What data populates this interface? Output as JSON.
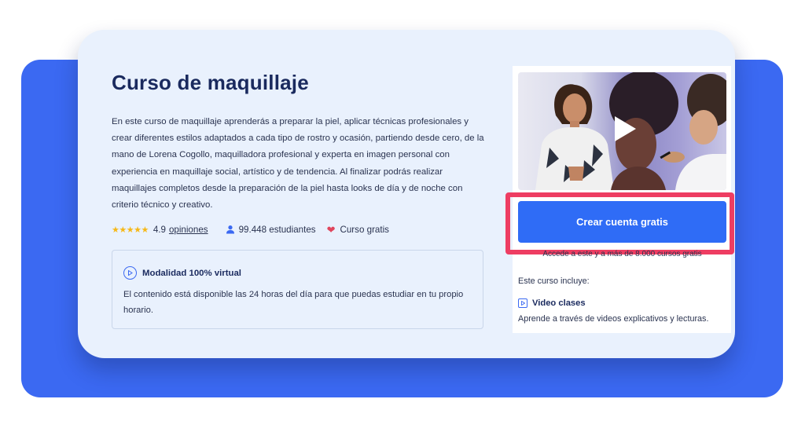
{
  "course": {
    "title": "Curso de maquillaje",
    "description": "En este curso de maquillaje aprenderás a preparar la piel, aplicar técnicas profesionales y crear diferentes estilos adaptados a cada tipo de rostro y ocasión, partiendo desde cero, de la mano de Lorena Cogollo, maquilladora profesional y experta en imagen personal con experiencia en maquillaje social, artístico y de tendencia. Al finalizar podrás realizar maquillajes completos desde la preparación de la piel hasta looks de día y de noche con criterio técnico y creativo."
  },
  "stats": {
    "stars": "★★★★★",
    "rating": "4.9",
    "reviews_link": "opiniones",
    "students": "99.448 estudiantes",
    "price_label": "Curso gratis"
  },
  "modality": {
    "title": "Modalidad 100% virtual",
    "text": "El contenido está disponible las 24 horas del día para que puedas estudiar en tu propio horario."
  },
  "sidebar": {
    "cta_label": "Crear cuenta gratis",
    "access_note": "Accede a este y a más de 8.000 cursos gratis",
    "includes_label": "Este curso incluye:",
    "feature_title": "Video clases",
    "feature_desc": "Aprende a través de videos explicativos y lecturas."
  },
  "colors": {
    "accent": "#2f6cf6",
    "background_block": "#3b69f2",
    "card": "#e9f1fd",
    "highlight": "#ee3d62",
    "stars": "#f6b817",
    "heart": "#e0455c"
  },
  "icons": [
    "star-icon",
    "user-icon",
    "heart-icon",
    "play-circle-icon",
    "play-button-icon",
    "play-square-icon"
  ]
}
